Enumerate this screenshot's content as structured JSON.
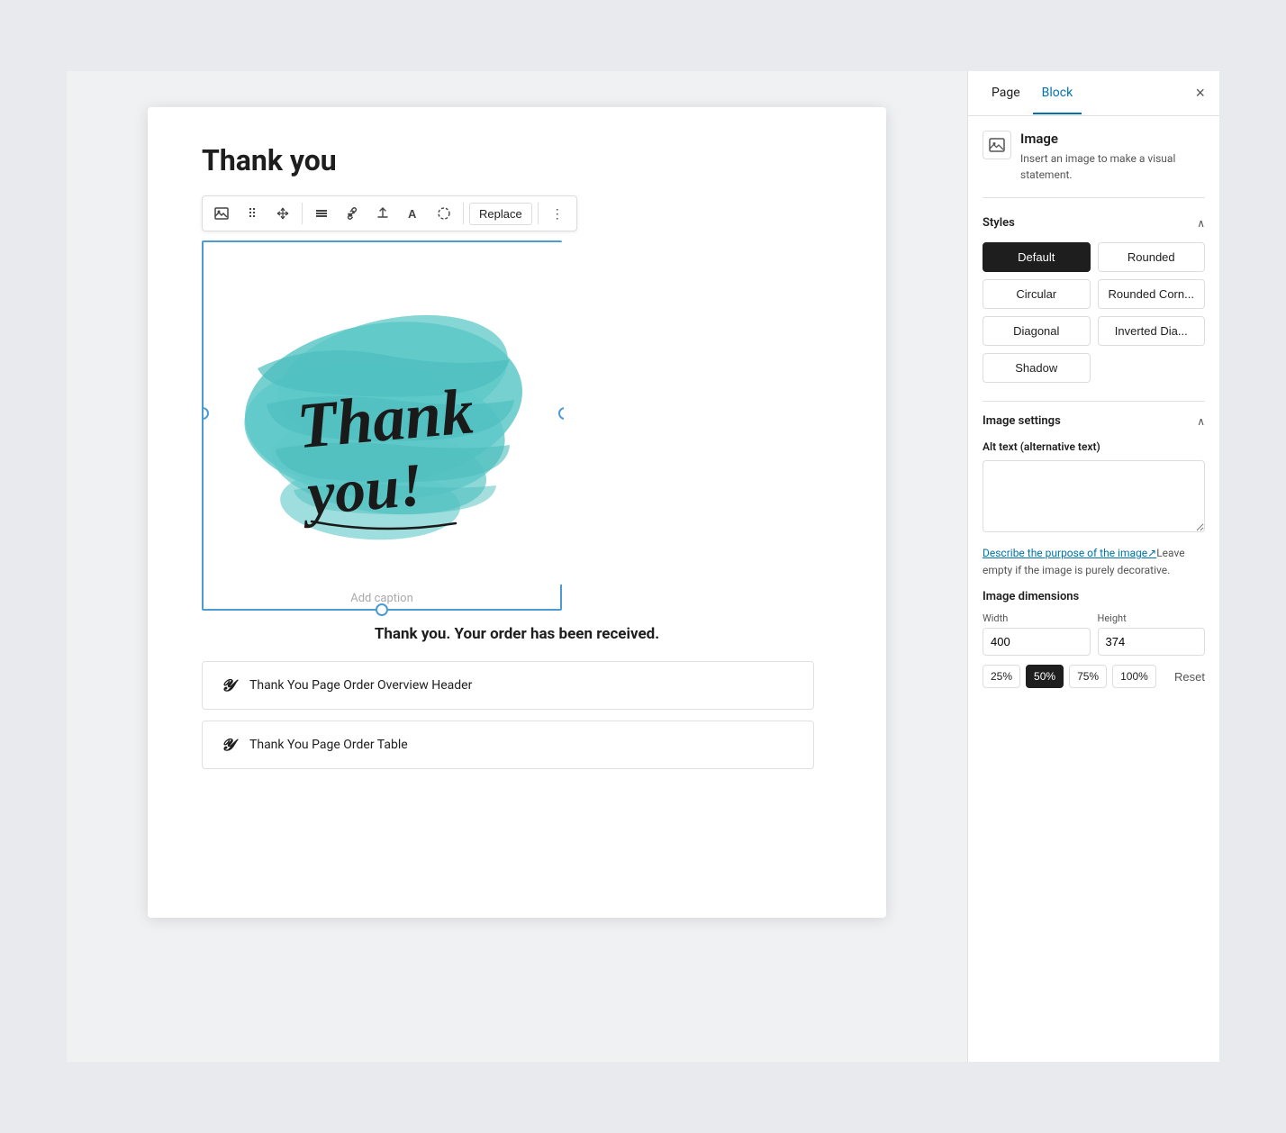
{
  "page": {
    "title": "Thank you",
    "order_text": "Thank you. Your order has been received."
  },
  "toolbar": {
    "replace_label": "Replace",
    "more_label": "⋮"
  },
  "image": {
    "caption_placeholder": "Add caption"
  },
  "blocks": [
    {
      "id": "order-overview-header",
      "icon": "𝓨",
      "label": "Thank You Page Order Overview Header"
    },
    {
      "id": "order-table",
      "icon": "𝓨",
      "label": "Thank You Page Order Table"
    }
  ],
  "panel": {
    "tabs": [
      "Page",
      "Block"
    ],
    "active_tab": "Block",
    "close_label": "×",
    "block_title": "Image",
    "block_description": "Insert an image to make a visual statement.",
    "styles_section_title": "Styles",
    "styles": [
      {
        "id": "default",
        "label": "Default",
        "active": true
      },
      {
        "id": "rounded",
        "label": "Rounded",
        "active": false
      },
      {
        "id": "circular",
        "label": "Circular",
        "active": false
      },
      {
        "id": "rounded-corn",
        "label": "Rounded Corn...",
        "active": false
      },
      {
        "id": "diagonal",
        "label": "Diagonal",
        "active": false
      },
      {
        "id": "inverted-dia",
        "label": "Inverted Dia...",
        "active": false
      },
      {
        "id": "shadow",
        "label": "Shadow",
        "active": false
      }
    ],
    "image_settings_title": "Image settings",
    "alt_text_label": "Alt text (alternative text)",
    "alt_text_value": "",
    "alt_text_link": "Describe the purpose of the image",
    "alt_text_hint": "Leave empty if the image is purely decorative.",
    "dimensions_label": "Image dimensions",
    "width_label": "Width",
    "height_label": "Height",
    "width_value": "400",
    "height_value": "374",
    "percent_options": [
      "25%",
      "50%",
      "75%",
      "100%"
    ],
    "active_percent": "50%",
    "reset_label": "Reset"
  }
}
